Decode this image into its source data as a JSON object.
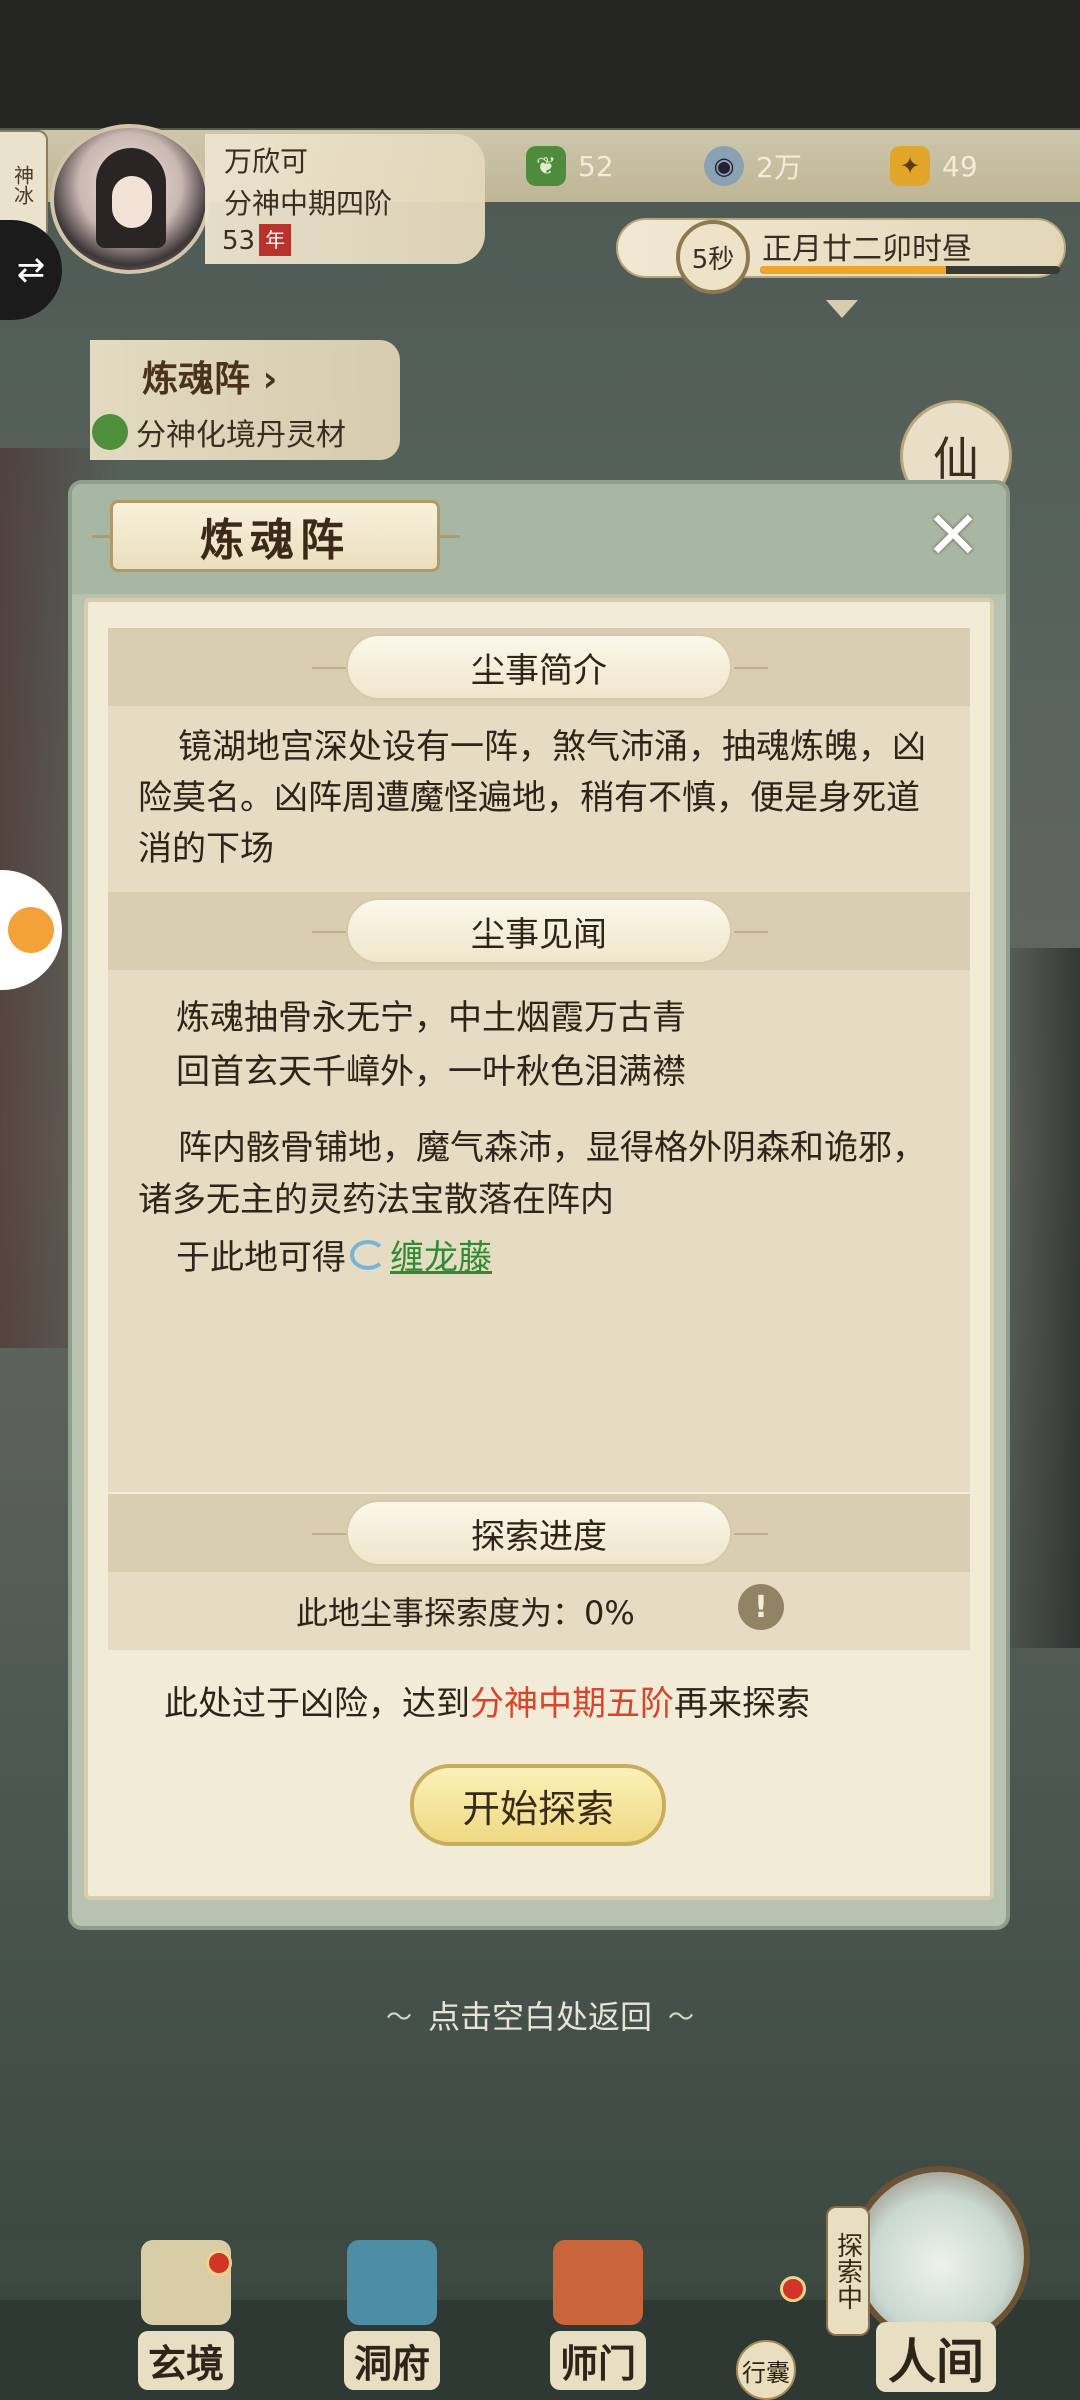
{
  "hud": {
    "side_badge": "神冰",
    "player": {
      "name": "万欣可",
      "rank": "分神中期四阶",
      "age": "53",
      "age_tag": "年"
    },
    "resources": [
      {
        "icon": "jade-leaf-icon",
        "value": "52"
      },
      {
        "icon": "coin-icon",
        "value": "2万"
      },
      {
        "icon": "strength-icon",
        "value": "49"
      }
    ],
    "timer": {
      "seconds": "5秒",
      "label": "正月廿二卯时昼",
      "progress": 0.62
    },
    "location": {
      "title": "炼魂阵",
      "chevron": "›",
      "subtitle": "分神化境丹灵材"
    },
    "right_deco": "仙"
  },
  "modal": {
    "title": "炼魂阵",
    "close_symbol": "✕",
    "sections": {
      "intro": {
        "label": "尘事简介",
        "text": "镜湖地宫深处设有一阵，煞气沛涌，抽魂炼魄，凶险莫名。凶阵周遭魔怪遍地，稍有不慎，便是身死道消的下场"
      },
      "story": {
        "label": "尘事见闻",
        "poem_line_1": "炼魂抽骨永无宁，中土烟霞万古青",
        "poem_line_2": "回首玄天千嶂外，一叶秋色泪满襟",
        "text": "阵内骸骨铺地，魔气森沛，显得格外阴森和诡邪，诸多无主的灵药法宝散落在阵内",
        "loot_prefix": "于此地可得",
        "loot_item": "缠龙藤"
      },
      "progress": {
        "label": "探索进度",
        "text": "此地尘事探索度为：0%",
        "value": 0,
        "warn_symbol": "!"
      }
    },
    "requirement": {
      "prefix": "此处过于凶险，达到",
      "highlight": "分神中期五阶",
      "suffix": "再来探索"
    },
    "start_button": "开始探索"
  },
  "tap_back": {
    "text": "点击空白处返回",
    "deco_left": "〜",
    "deco_right": "〜"
  },
  "bottom_nav": {
    "items": [
      {
        "label": "玄境"
      },
      {
        "label": "洞府"
      },
      {
        "label": "师门"
      }
    ],
    "bag_label": "行囊",
    "explore_tag": "探索中",
    "world_label": "人间"
  },
  "colors": {
    "accent_red": "#d8452b",
    "link_green": "#2f8a35",
    "button_gold": "#efd983"
  }
}
